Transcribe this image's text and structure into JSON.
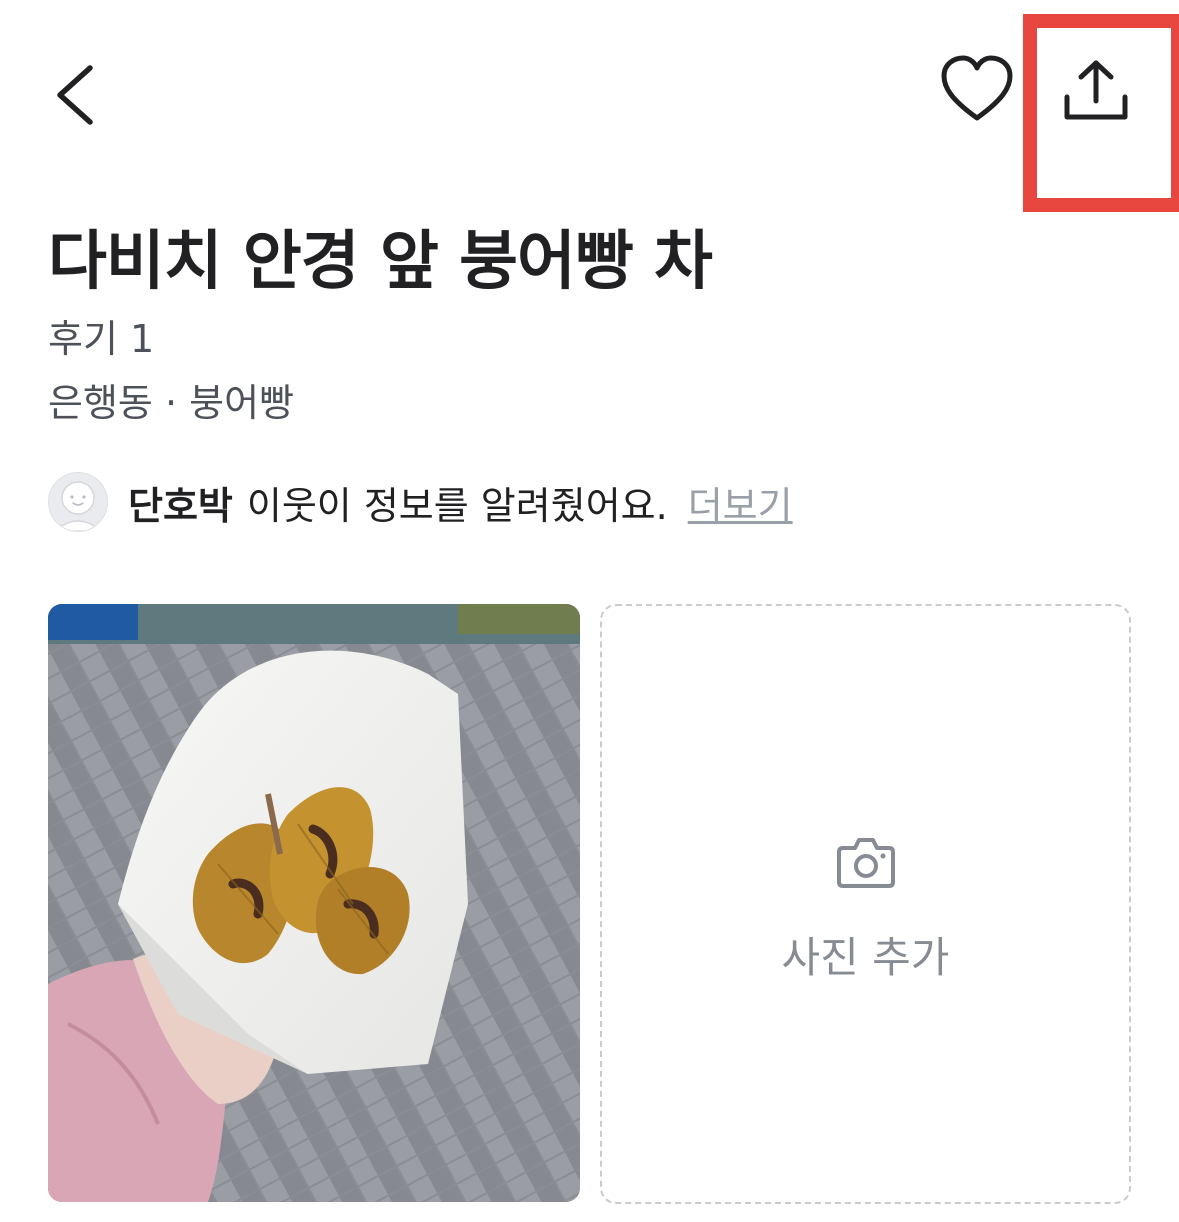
{
  "header": {
    "back_icon": "chevron-left-icon",
    "favorite_icon": "heart-outline-icon",
    "share_icon": "share-upload-icon",
    "highlight_color": "#e8473f"
  },
  "store": {
    "title": "다비치 안경 앞 붕어빵 차",
    "review_count": "후기 1",
    "location_category": "은행동 · 붕어빵"
  },
  "contributor": {
    "avatar_icon": "default-avatar-icon",
    "name": "단호박",
    "message": "이웃이 정보를 알려줬어요.",
    "more_label": "더보기"
  },
  "photos": {
    "add_photo_icon": "camera-icon",
    "add_photo_label": "사진 추가"
  }
}
